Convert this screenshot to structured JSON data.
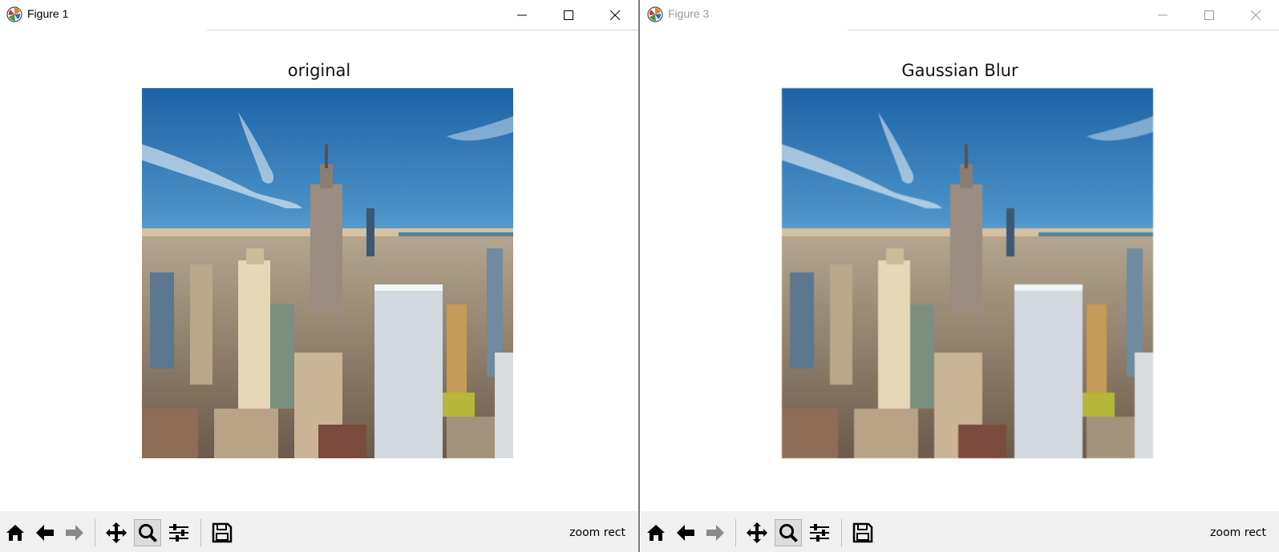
{
  "windows": [
    {
      "title": "Figure 1",
      "plot_title": "original",
      "status": "zoom rect",
      "inactive": false
    },
    {
      "title": "Figure 3",
      "plot_title": "Gaussian Blur",
      "status": "zoom rect",
      "inactive": true
    }
  ],
  "toolbar_icons": [
    "home-icon",
    "back-arrow-icon",
    "forward-arrow-icon",
    "pan-icon",
    "zoom-magnifier-icon",
    "configure-subplots-icon",
    "save-floppy-icon"
  ],
  "active_tool": "zoom-magnifier-icon",
  "colors": {
    "toolbar_bg": "#f0f0f0",
    "sky_top": "#1e63a6",
    "sky_horizon": "#e9d8b6",
    "river": "#4f86a6"
  }
}
